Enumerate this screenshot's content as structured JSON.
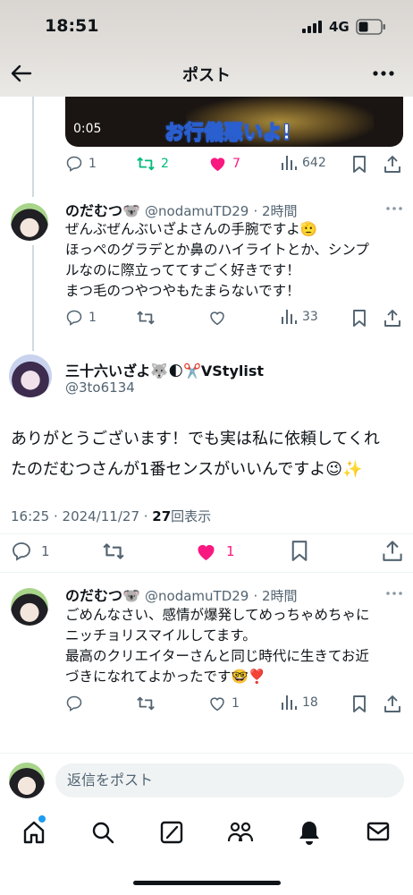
{
  "status_bar": {
    "time": "18:51",
    "network": "4G"
  },
  "nav": {
    "title": "ポスト"
  },
  "prev_post": {
    "video_duration": "0:05",
    "video_overlay_text": "お行儀悪いよ!",
    "actions": {
      "replies": "1",
      "reposts": "2",
      "likes": "7",
      "views": "642"
    }
  },
  "reply1": {
    "name": "のだむつ🐨",
    "handle": "@nodamuTD29",
    "time": "· 2時間",
    "lines": [
      "ぜんぶぜんぶいざよさんの手腕ですよ🫡",
      "ほっぺのグラデとか鼻のハイライトとか、シンプ",
      "ルなのに際立っててすごく好きです！",
      "まつ毛のつやつやもたまらないです！"
    ],
    "actions": {
      "replies": "1",
      "reposts": "",
      "likes": "",
      "views": "33"
    }
  },
  "main_post": {
    "name": "三十六いざよ🐺🌓✂️VStylist",
    "handle": "@3to6134",
    "lines": [
      "ありがとうございます！でも実は私に依頼してくれ",
      "たのだむつさんが1番センスがいいんですよ😉✨"
    ],
    "timestamp": "16:25 · 2024/11/27 · ",
    "views_count": "27",
    "views_label": "回表示",
    "actions": {
      "replies": "1",
      "likes": "1"
    }
  },
  "reply2": {
    "name": "のだむつ🐨",
    "handle": "@nodamuTD29",
    "time": "· 2時間",
    "lines": [
      "ごめんなさい、感情が爆発してめっちゃめちゃに",
      "ニッチョリスマイルしてます。",
      "最高のクリエイターさんと同じ時代に生きてお近",
      "づきになれてよかったです🤓❣️"
    ],
    "actions": {
      "replies": "",
      "reposts": "",
      "likes": "1",
      "views": "18"
    }
  },
  "reply_box": {
    "placeholder": "返信をポスト"
  },
  "colors": {
    "like": "#f91880",
    "repost": "#00ba7c",
    "accent": "#1d9bf0",
    "text": "#0f1419",
    "muted": "#536471"
  },
  "icons": [
    "back-arrow-icon",
    "more-icon",
    "reply-icon",
    "repost-icon",
    "like-icon",
    "views-icon",
    "bookmark-icon",
    "share-icon",
    "home-icon",
    "search-icon",
    "grok-icon",
    "communities-icon",
    "notifications-icon",
    "messages-icon"
  ]
}
